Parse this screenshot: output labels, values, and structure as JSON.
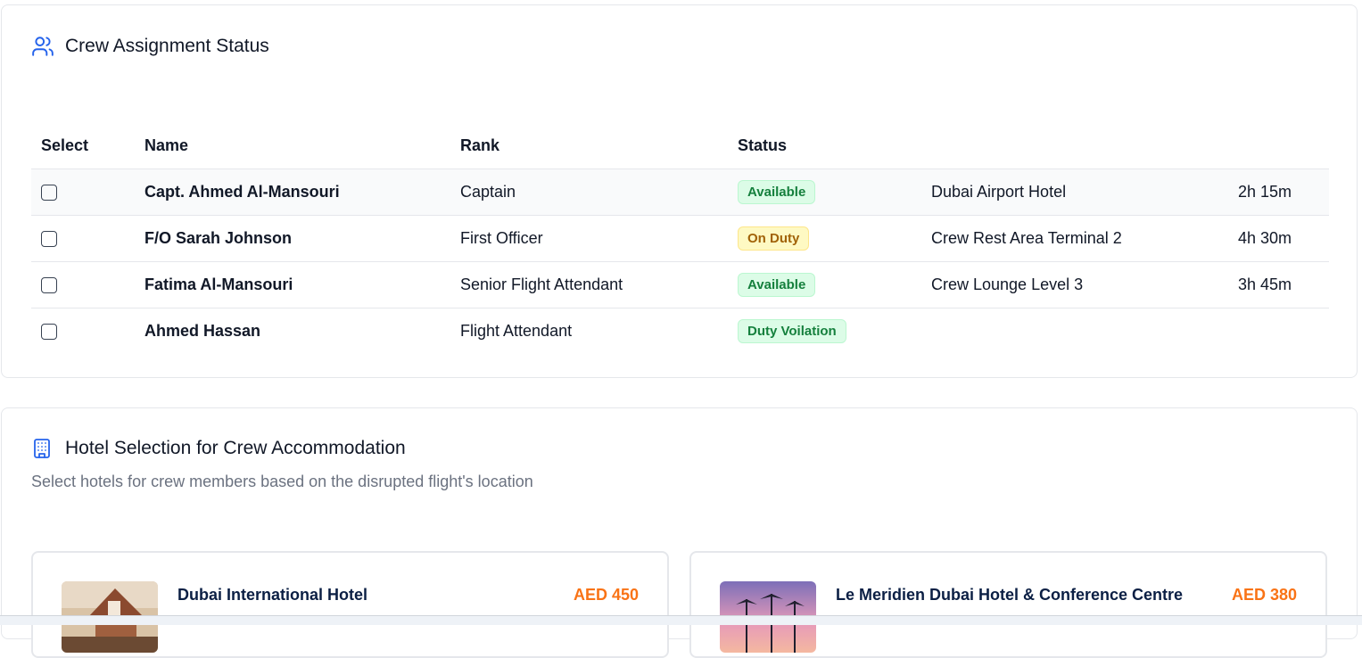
{
  "crew_section": {
    "title": "Crew Assignment Status",
    "icon": "users-icon",
    "columns": [
      "Select",
      "Name",
      "Rank",
      "Status"
    ],
    "rows": [
      {
        "name": "Capt. Ahmed Al-Mansouri",
        "rank": "Captain",
        "status": "Available",
        "location": "Dubai Airport Hotel",
        "duration": "2h 15m"
      },
      {
        "name": "F/O Sarah Johnson",
        "rank": "First Officer",
        "status": "On Duty",
        "location": "Crew Rest Area Terminal 2",
        "duration": "4h 30m"
      },
      {
        "name": "Fatima Al-Mansouri",
        "rank": "Senior Flight Attendant",
        "status": "Available",
        "location": "Crew Lounge Level 3",
        "duration": "3h 45m"
      },
      {
        "name": "Ahmed Hassan",
        "rank": "Flight Attendant",
        "status": "Duty Voilation",
        "location": "",
        "duration": ""
      }
    ]
  },
  "hotel_section": {
    "title": "Hotel Selection for Crew Accommodation",
    "icon": "building-icon",
    "description": "Select hotels for crew members based on the disrupted flight's location",
    "hotels": [
      {
        "name": "Dubai International Hotel",
        "price": "AED 450"
      },
      {
        "name": "Le Meridien Dubai Hotel & Conference Centre",
        "price": "AED 380"
      }
    ]
  },
  "colors": {
    "accent": "#2563eb",
    "price": "#f97316",
    "status_green": "#15803d",
    "status_yellow": "#a16207"
  }
}
